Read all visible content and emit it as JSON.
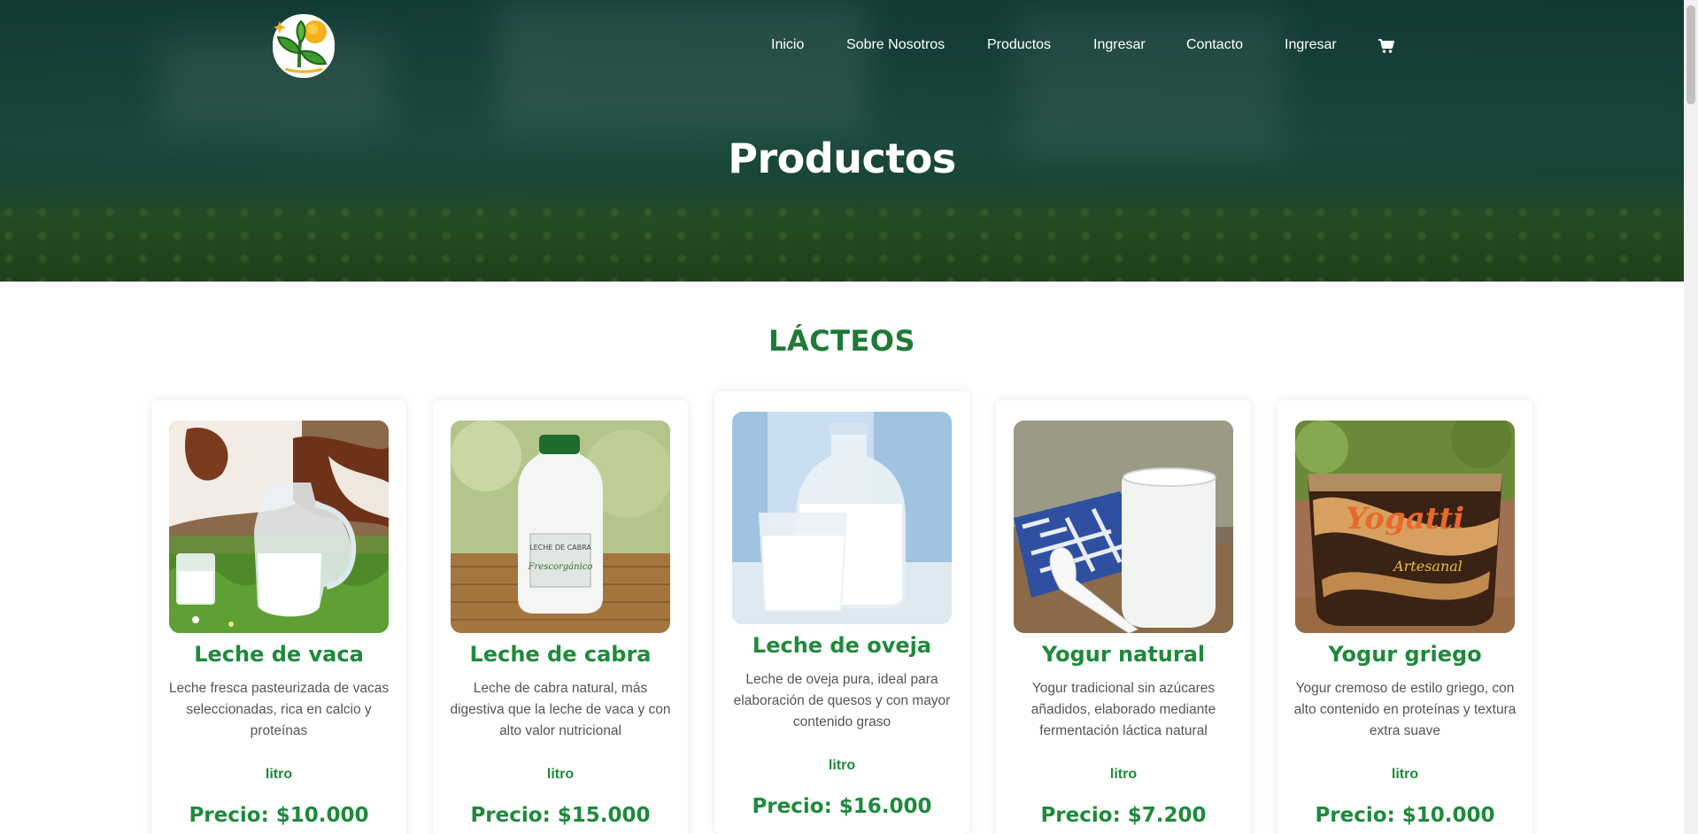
{
  "nav": {
    "items": [
      {
        "label": "Inicio"
      },
      {
        "label": "Sobre Nosotros"
      },
      {
        "label": "Productos"
      },
      {
        "label": "Ingresar"
      },
      {
        "label": "Contacto"
      },
      {
        "label": "Ingresar"
      }
    ],
    "cart_icon": "shopping-cart-icon"
  },
  "hero": {
    "title": "Productos"
  },
  "section": {
    "title": "LÁCTEOS"
  },
  "products": [
    {
      "name": "Leche de vaca",
      "description": "Leche fresca pasteurizada de vacas seleccionadas, rica en calcio y proteínas",
      "unit": "litro",
      "price": "Precio: $10.000"
    },
    {
      "name": "Leche de cabra",
      "description": "Leche de cabra natural, más digestiva que la leche de vaca y con alto valor nutricional",
      "unit": "litro",
      "price": "Precio: $15.000",
      "image_text": {
        "label": "LECHE DE CABRA",
        "brand": "Frescorgánico"
      }
    },
    {
      "name": "Leche de oveja",
      "description": "Leche de oveja pura, ideal para elaboración de quesos y con mayor contenido graso",
      "unit": "litro",
      "price": "Precio: $16.000"
    },
    {
      "name": "Yogur natural",
      "description": "Yogur tradicional sin azúcares añadidos, elaborado mediante fermentación láctica natural",
      "unit": "litro",
      "price": "Precio: $7.200"
    },
    {
      "name": "Yogur griego",
      "description": "Yogur cremoso de estilo griego, con alto contenido en proteínas y textura extra suave",
      "unit": "litro",
      "price": "Precio: $10.000",
      "image_text": {
        "brand": "Yogatti",
        "sub": "Artesanal"
      }
    }
  ],
  "colors": {
    "accent": "#1e8a3c",
    "heading": "#1e7a36",
    "text": "#555555"
  }
}
